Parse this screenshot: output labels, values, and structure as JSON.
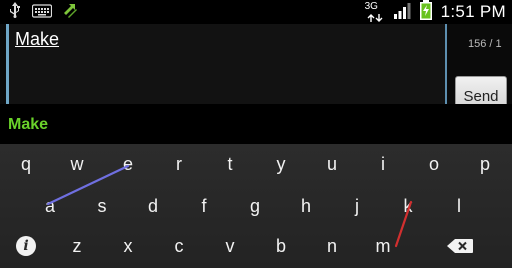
{
  "status_bar": {
    "time": "1:51 PM",
    "network_label": "3G",
    "icons": [
      "usb-icon",
      "keyboard-icon",
      "data-sync-icon",
      "signal-icon",
      "battery-charging-icon"
    ]
  },
  "compose": {
    "text": "Make",
    "char_counter": "156 / 1",
    "send_label": "Send"
  },
  "suggestions": {
    "words": [
      "Make"
    ]
  },
  "keyboard": {
    "row1": [
      "q",
      "w",
      "e",
      "r",
      "t",
      "y",
      "u",
      "i",
      "o",
      "p"
    ],
    "row2": [
      "a",
      "s",
      "d",
      "f",
      "g",
      "h",
      "j",
      "k",
      "l"
    ],
    "row3": [
      "z",
      "x",
      "c",
      "v",
      "b",
      "n",
      "m"
    ],
    "info_key": "i",
    "backspace_icon": "backspace-icon",
    "colors": {
      "swipe_trail_1": "#6f6fe0",
      "swipe_trail_2": "#d12f2f",
      "suggestion": "#6ad12a"
    }
  }
}
